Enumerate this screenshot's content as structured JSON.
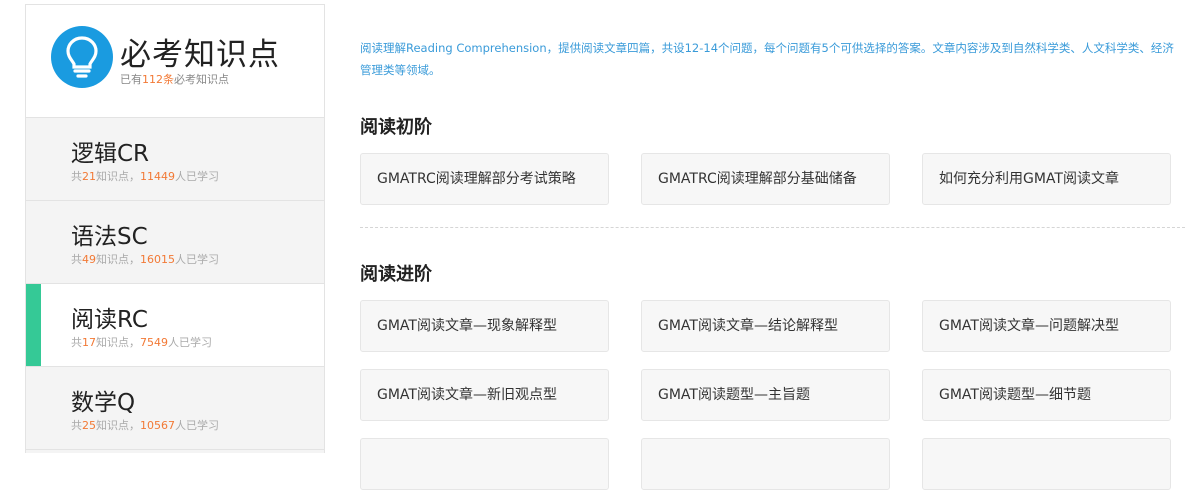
{
  "sidebar": {
    "title": "必考知识点",
    "subtitle_prefix": "已有",
    "subtitle_count": "112条",
    "subtitle_suffix": "必考知识点",
    "categories": [
      {
        "name": "逻辑CR",
        "prefix": "共",
        "points": "21",
        "mid": "知识点，",
        "learners": "11449",
        "suffix": "人已学习"
      },
      {
        "name": "语法SC",
        "prefix": "共",
        "points": "49",
        "mid": "知识点，",
        "learners": "16015",
        "suffix": "人已学习"
      },
      {
        "name": "阅读RC",
        "prefix": "共",
        "points": "17",
        "mid": "知识点，",
        "learners": "7549",
        "suffix": "人已学习"
      },
      {
        "name": "数学Q",
        "prefix": "共",
        "points": "25",
        "mid": "知识点，",
        "learners": "10567",
        "suffix": "人已学习"
      }
    ]
  },
  "main": {
    "intro": "阅读理解Reading Comprehension，提供阅读文章四篇，共设12-14个问题，每个问题有5个可供选择的答案。文章内容涉及到自然科学类、人文科学类、经济管理类等领域。",
    "sections": [
      {
        "title": "阅读初阶",
        "cards": [
          "GMATRC阅读理解部分考试策略",
          "GMATRC阅读理解部分基础储备",
          "如何充分利用GMAT阅读文章"
        ]
      },
      {
        "title": "阅读进阶",
        "cards": [
          "GMAT阅读文章—现象解释型",
          "GMAT阅读文章—结论解释型",
          "GMAT阅读文章—问题解决型",
          "GMAT阅读文章—新旧观点型",
          "GMAT阅读题型—主旨题",
          "GMAT阅读题型—细节题",
          "",
          "",
          ""
        ]
      }
    ]
  },
  "colors": {
    "accent_green": "#35c996",
    "accent_orange": "#f27935",
    "link_blue": "#3a9bd9",
    "bulb_blue": "#1a9be0"
  },
  "icons": {
    "header": "lightbulb-icon"
  }
}
